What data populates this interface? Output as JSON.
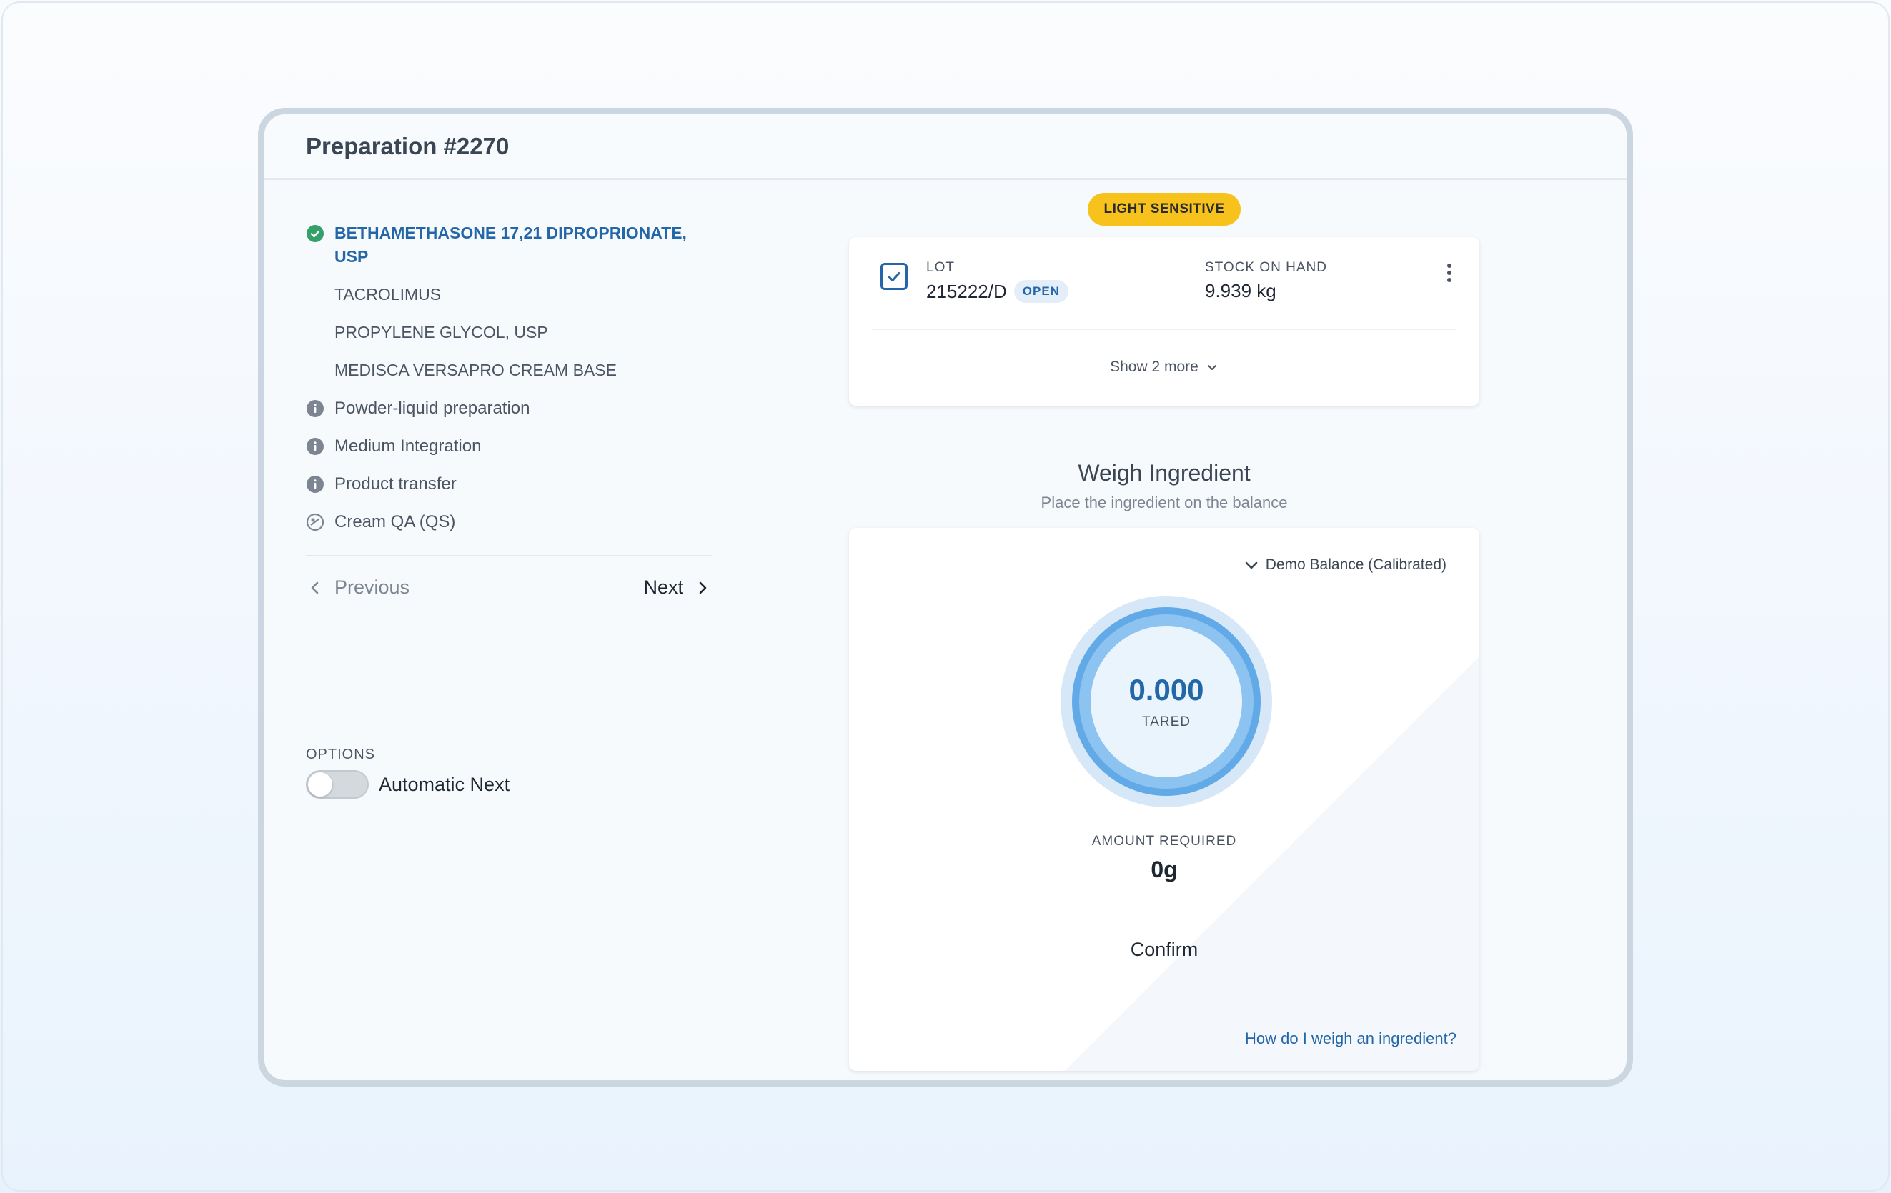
{
  "preparation": {
    "title": "Preparation #2270"
  },
  "ingredients": [
    {
      "label": "BETHAMETHASONE 17,21 DIPROPRIONATE, USP",
      "state": "complete",
      "icon": "check-circle-icon"
    },
    {
      "label": "TACROLIMUS",
      "state": "pending"
    },
    {
      "label": "PROPYLENE GLYCOL, USP",
      "state": "pending"
    },
    {
      "label": "MEDISCA VERSAPRO CREAM BASE",
      "state": "pending"
    }
  ],
  "steps": [
    {
      "label": "Powder-liquid preparation",
      "icon": "info-icon"
    },
    {
      "label": "Medium Integration",
      "icon": "info-icon"
    },
    {
      "label": "Product transfer",
      "icon": "info-icon"
    },
    {
      "label": "Cream QA (QS)",
      "icon": "qa-icon"
    }
  ],
  "nav": {
    "previous_label": "Previous",
    "next_label": "Next"
  },
  "options": {
    "label": "OPTIONS",
    "automatic_next_label": "Automatic Next",
    "automatic_next_on": false
  },
  "badge": {
    "label": "LIGHT SENSITIVE",
    "color": "#f6c21b"
  },
  "lot": {
    "label": "LOT",
    "value": "215222/D",
    "status": "OPEN",
    "stock_label": "STOCK ON HAND",
    "stock_value": "9.939 kg",
    "show_more_label": "Show 2 more"
  },
  "weigh": {
    "title": "Weigh Ingredient",
    "subtitle": "Place the ingredient on the balance",
    "balance_label": "Demo Balance (Calibrated)",
    "reading": "0.000",
    "reading_status": "TARED",
    "amount_label": "AMOUNT REQUIRED",
    "amount_value": "0g",
    "confirm_label": "Confirm",
    "help_link": "How do I weigh an ingredient?"
  },
  "colors": {
    "accent": "#2467a8",
    "success": "#34a06a",
    "ring": "#62aae7"
  }
}
